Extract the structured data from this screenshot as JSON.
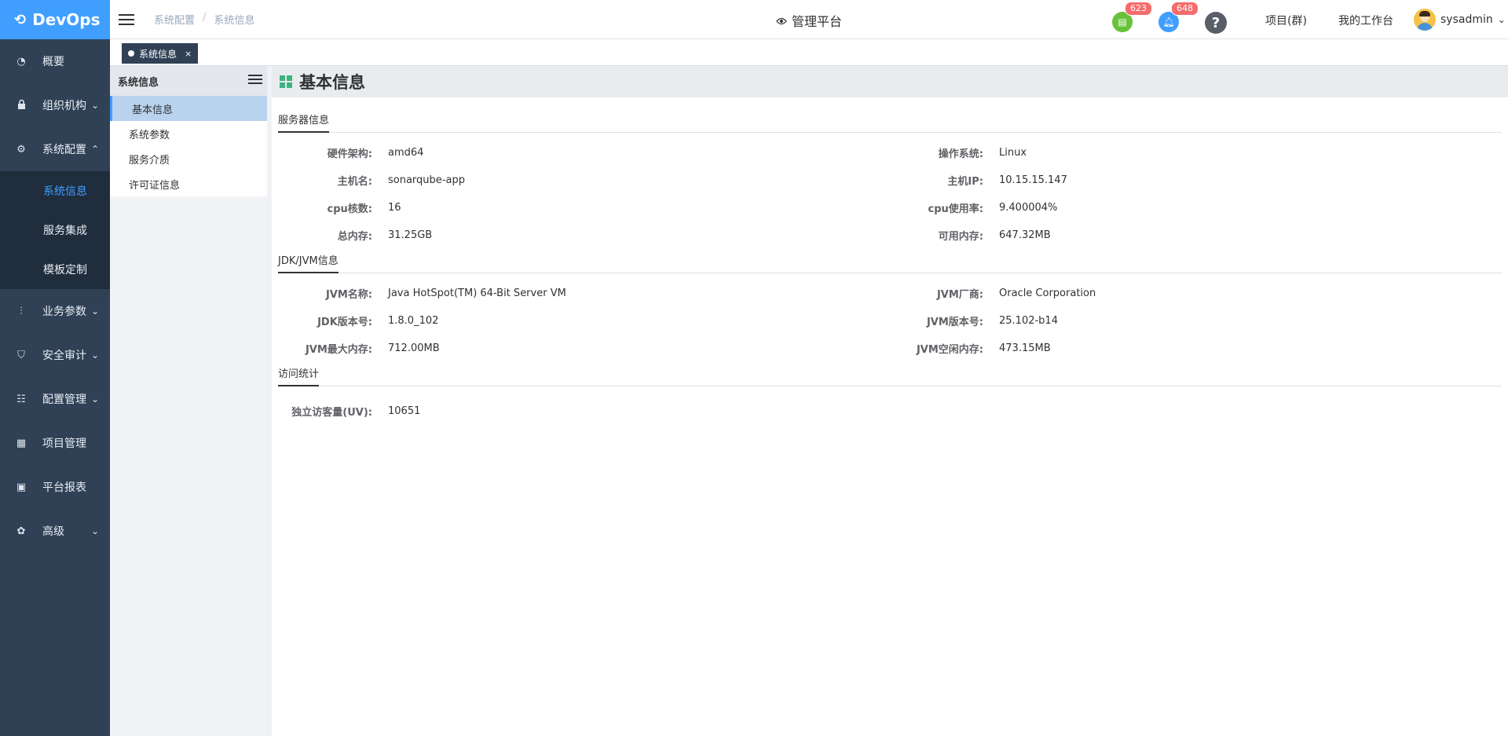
{
  "app": {
    "logo_text": "DevOps"
  },
  "sidebar": {
    "items": [
      {
        "label": "概要"
      },
      {
        "label": "组织机构"
      },
      {
        "label": "系统配置"
      },
      {
        "label": "业务参数"
      },
      {
        "label": "安全审计"
      },
      {
        "label": "配置管理"
      },
      {
        "label": "项目管理"
      },
      {
        "label": "平台报表"
      },
      {
        "label": "高级"
      }
    ],
    "submenu": [
      {
        "label": "系统信息"
      },
      {
        "label": "服务集成"
      },
      {
        "label": "模板定制"
      }
    ]
  },
  "header": {
    "breadcrumb": [
      "系统配置",
      "系统信息"
    ],
    "breadcrumb_sep": "/",
    "title": "管理平台",
    "todo_count": "623",
    "notify_count": "648",
    "help_symbol": "?",
    "project_link": "项目(群)",
    "workbench_link": "我的工作台",
    "username": "sysadmin"
  },
  "tabs": [
    {
      "label": "系统信息",
      "close": "×"
    }
  ],
  "subpanel": {
    "title": "系统信息",
    "items": [
      {
        "label": "基本信息"
      },
      {
        "label": "系统参数"
      },
      {
        "label": "服务介质"
      },
      {
        "label": "许可证信息"
      }
    ]
  },
  "main": {
    "title": "基本信息",
    "server": {
      "heading": "服务器信息",
      "rows": [
        {
          "l1": "硬件架构:",
          "v1": "amd64",
          "l2": "操作系统:",
          "v2": "Linux"
        },
        {
          "l1": "主机名:",
          "v1": "sonarqube-app",
          "l2": "主机IP:",
          "v2": "10.15.15.147"
        },
        {
          "l1": "cpu核数:",
          "v1": "16",
          "l2": "cpu使用率:",
          "v2": "9.400004%"
        },
        {
          "l1": "总内存:",
          "v1": "31.25GB",
          "l2": "可用内存:",
          "v2": "647.32MB"
        }
      ]
    },
    "jvm": {
      "heading": "JDK/JVM信息",
      "rows": [
        {
          "l1": "JVM名称:",
          "v1": "Java HotSpot(TM) 64-Bit Server VM",
          "l2": "JVM厂商:",
          "v2": "Oracle Corporation"
        },
        {
          "l1": "JDK版本号:",
          "v1": "1.8.0_102",
          "l2": "JVM版本号:",
          "v2": "25.102-b14"
        },
        {
          "l1": "JVM最大内存:",
          "v1": "712.00MB",
          "l2": "JVM空闲内存:",
          "v2": "473.15MB"
        }
      ]
    },
    "visits": {
      "heading": "访问统计",
      "rows": [
        {
          "l1": "独立访客量(UV):",
          "v1": "10651"
        }
      ]
    }
  },
  "icons": {
    "logo": "devops-logo-icon",
    "overview": "dashboard-icon",
    "org": "lock-icon",
    "sysconfig": "gear-icon",
    "business": "sliders-icon",
    "audit": "shield-icon",
    "confmgmt": "database-icon",
    "project": "grid-icon",
    "report": "monitor-icon",
    "advanced": "palette-icon"
  },
  "colors": {
    "sidebar": "#304156",
    "logo_bg": "#409eff",
    "active": "#409eff",
    "badge": "#f56c6c",
    "todo": "#67c23a",
    "notify": "#409eff",
    "accent_green": "#3fb37f"
  }
}
